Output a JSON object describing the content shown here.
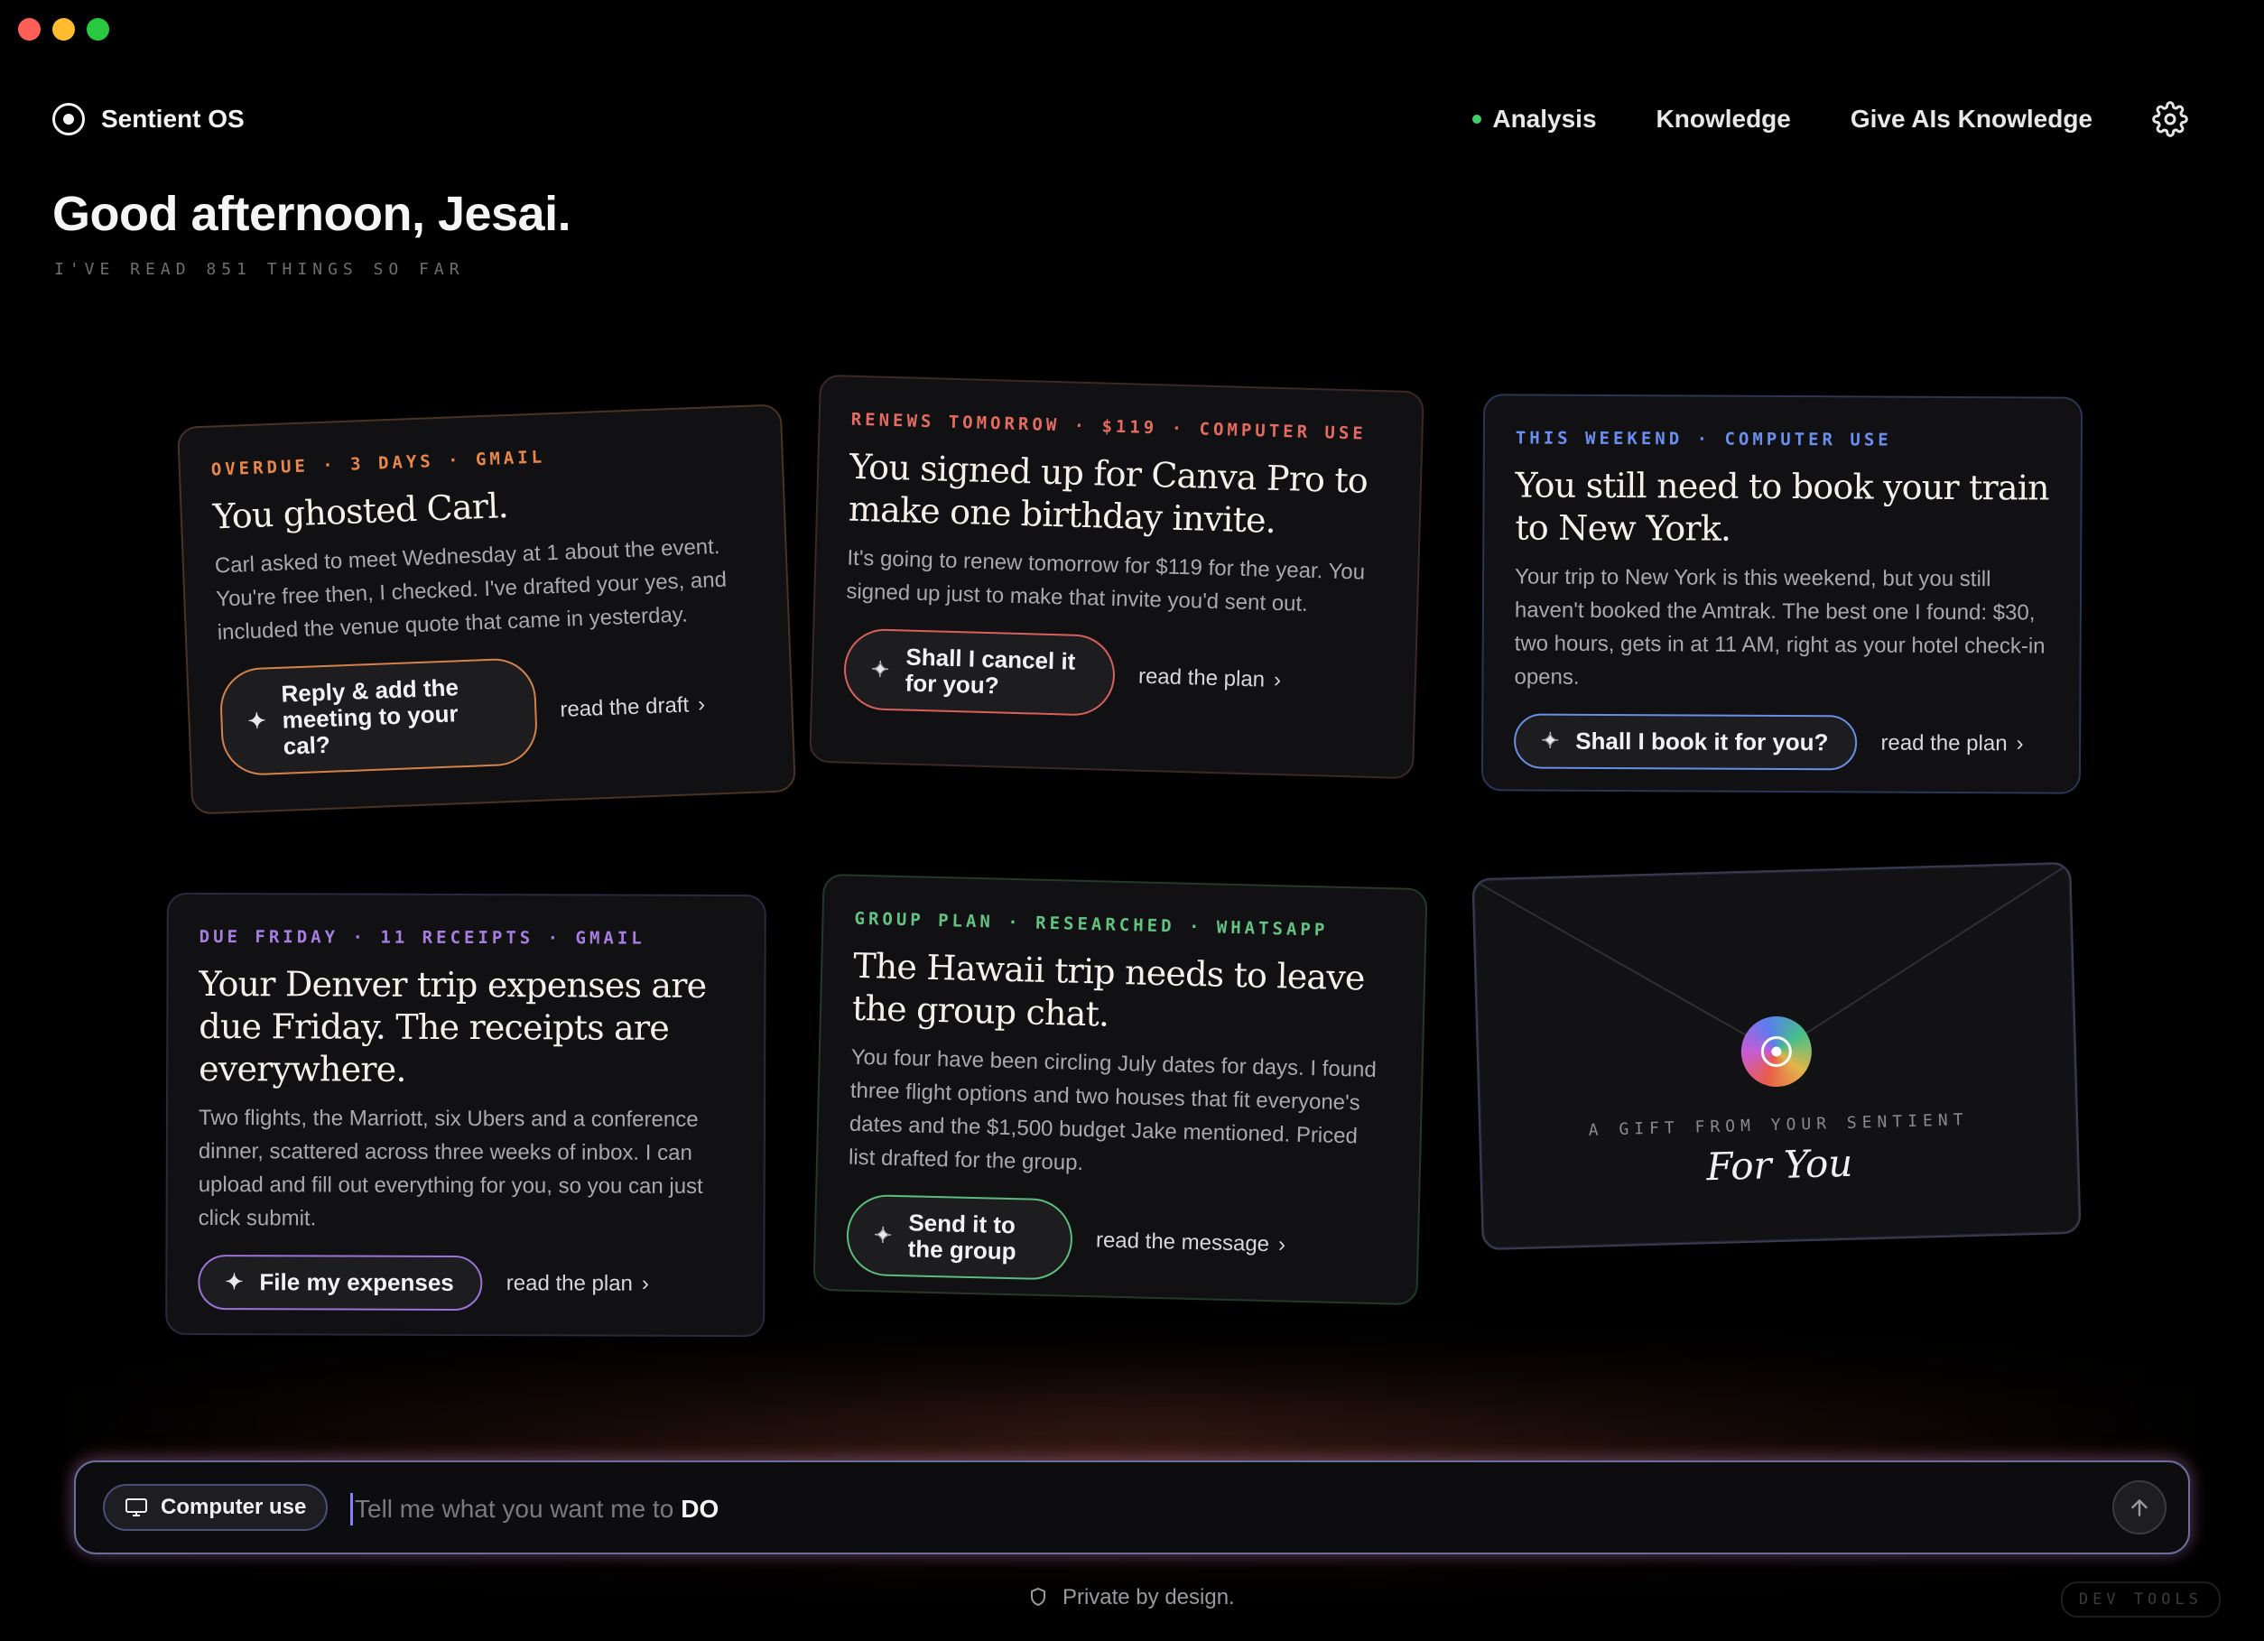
{
  "app": {
    "name": "Sentient OS"
  },
  "nav": {
    "items": [
      {
        "label": "Analysis"
      },
      {
        "label": "Knowledge"
      },
      {
        "label": "Give AIs Knowledge"
      }
    ]
  },
  "greeting": "Good afternoon, Jesai.",
  "subline": "I'VE READ 851 THINGS SO FAR",
  "cards": [
    {
      "tag": "OVERDUE · 3 DAYS · GMAIL",
      "title": "You ghosted Carl.",
      "body": "Carl asked to meet Wednesday at 1 about the event. You're free then, I checked. I've drafted your yes, and included the venue quote that came in yesterday.",
      "action": "Reply & add the meeting to your cal?",
      "link": "read the draft",
      "accent": "#e8874a"
    },
    {
      "tag": "RENEWS TOMORROW · $119 · COMPUTER USE",
      "title": "You signed up for Canva Pro to make one birthday invite.",
      "body": "It's going to renew tomorrow for $119 for the year. You signed up just to make that invite you'd sent out.",
      "action": "Shall I cancel it for you?",
      "link": "read the plan",
      "accent": "#e46b60"
    },
    {
      "tag": "THIS WEEKEND · COMPUTER USE",
      "title": "You still need to book your train to New York.",
      "body": "Your trip to New York is this weekend, but you still haven't booked the Amtrak. The best one I found: $30, two hours, gets in at 11 AM, right as your hotel check-in opens.",
      "action": "Shall I book it for you?",
      "link": "read the plan",
      "accent": "#6b8ff0"
    },
    {
      "tag": "DUE FRIDAY · 11 RECEIPTS · GMAIL",
      "title": "Your Denver trip expenses are due Friday. The receipts are everywhere.",
      "body": "Two flights, the Marriott, six Ubers and a conference dinner, scattered across three weeks of inbox. I can upload and fill out everything for you, so you can just click submit.",
      "action": "File my expenses",
      "link": "read the plan",
      "accent": "#a67ee0"
    },
    {
      "tag": "GROUP PLAN · RESEARCHED · WHATSAPP",
      "title": "The Hawaii trip needs to leave the group chat.",
      "body": "You four have been circling July dates for days. I found three flight options and two houses that fit everyone's dates and the $1,500 budget Jake mentioned. Priced list drafted for the group.",
      "action": "Send it to the group",
      "link": "read the message",
      "accent": "#62c383"
    }
  ],
  "gift": {
    "caption": "A GIFT FROM YOUR SENTIENT",
    "title": "For You"
  },
  "command": {
    "mode_label": "Computer use",
    "placeholder": "Tell me what you want me to",
    "placeholder_strong": "DO"
  },
  "footer": {
    "privacy": "Private by design.",
    "devtools": "DEV TOOLS"
  }
}
